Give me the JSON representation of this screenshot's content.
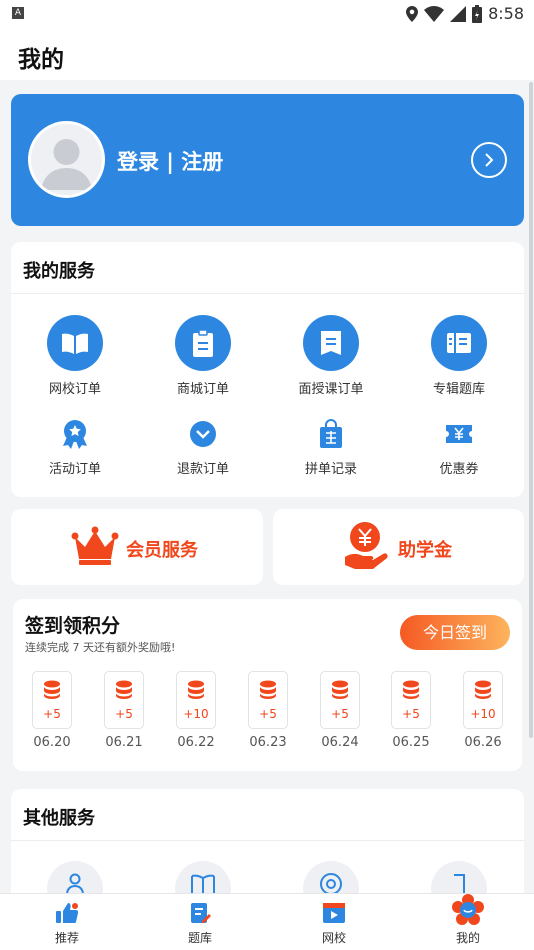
{
  "status_bar": {
    "time": "8:58",
    "notification_badge": "A"
  },
  "header": {
    "title": "我的"
  },
  "profile": {
    "login_label": "登录 | 注册"
  },
  "services": {
    "title": "我的服务",
    "items": [
      {
        "label": "网校订单",
        "icon": "book-icon"
      },
      {
        "label": "商城订单",
        "icon": "clipboard-icon"
      },
      {
        "label": "面授课订单",
        "icon": "document-icon"
      },
      {
        "label": "专辑题库",
        "icon": "question-bank-icon"
      },
      {
        "label": "活动订单",
        "icon": "badge-icon"
      },
      {
        "label": "退款订单",
        "icon": "chevron-down-icon"
      },
      {
        "label": "拼单记录",
        "icon": "group-buy-bag-icon"
      },
      {
        "label": "优惠券",
        "icon": "coupon-icon"
      }
    ]
  },
  "promos": {
    "member": "会员服务",
    "aid": "助学金"
  },
  "signin": {
    "title": "签到领积分",
    "subtitle": "连续完成 7 天还有额外奖励哦!",
    "button": "今日签到",
    "days": [
      {
        "points": "+5",
        "date": "06.20"
      },
      {
        "points": "+5",
        "date": "06.21"
      },
      {
        "points": "+10",
        "date": "06.22"
      },
      {
        "points": "+5",
        "date": "06.23"
      },
      {
        "points": "+5",
        "date": "06.24"
      },
      {
        "points": "+5",
        "date": "06.25"
      },
      {
        "points": "+10",
        "date": "06.26"
      }
    ]
  },
  "other_services": {
    "title": "其他服务"
  },
  "bottom_nav": [
    {
      "label": "推荐",
      "icon": "thumbs-up-icon"
    },
    {
      "label": "题库",
      "icon": "question-bank-edit-icon"
    },
    {
      "label": "网校",
      "icon": "video-play-icon"
    },
    {
      "label": "我的",
      "icon": "flower-face-icon"
    }
  ],
  "colors": {
    "primary": "#2d87e0",
    "accent": "#f0471d",
    "background": "#f3f4f6"
  }
}
